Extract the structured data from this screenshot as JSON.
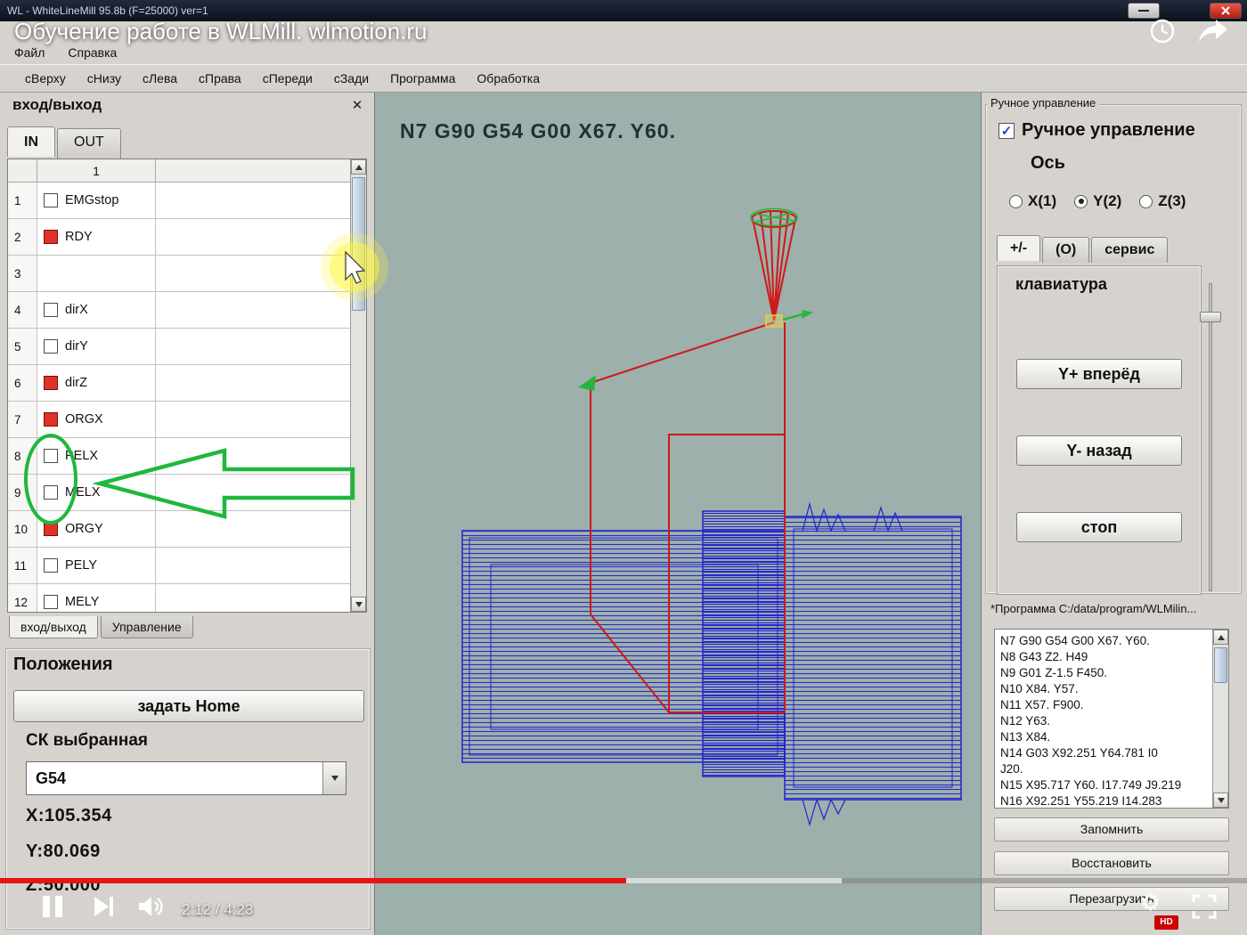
{
  "titlebar": {
    "title": "WL - WhiteLineMill 95.8b (F=25000) ver=1"
  },
  "video": {
    "title": "Обучение работе в WLMill. wlmotion.ru",
    "current_time": "2:12 / 4:23",
    "hd_badge": "HD",
    "progress_pct": 50.2,
    "buffer_pct": 67.5
  },
  "icons": {
    "close_panel": "✕",
    "check": "✓",
    "settings": "⚙"
  },
  "menubar": [
    "Файл",
    "Справка"
  ],
  "toolbar": [
    "сВерху",
    "сНизу",
    "сЛева",
    "сПрава",
    "сПереди",
    "сЗади",
    "Программа",
    "Обработка"
  ],
  "io_panel": {
    "title": "вход/выход",
    "tabs": [
      "IN",
      "OUT"
    ],
    "active_tab": "IN",
    "column_header": "1",
    "rows": [
      {
        "num": "1",
        "label": "EMGstop",
        "state": "off"
      },
      {
        "num": "2",
        "label": "RDY",
        "state": "on"
      },
      {
        "num": "3",
        "label": "",
        "state": "none"
      },
      {
        "num": "4",
        "label": "dirX",
        "state": "off"
      },
      {
        "num": "5",
        "label": "dirY",
        "state": "off"
      },
      {
        "num": "6",
        "label": "dirZ",
        "state": "on"
      },
      {
        "num": "7",
        "label": "ORGX",
        "state": "on"
      },
      {
        "num": "8",
        "label": "PELX",
        "state": "off"
      },
      {
        "num": "9",
        "label": "MELX",
        "state": "off"
      },
      {
        "num": "10",
        "label": "ORGY",
        "state": "on"
      },
      {
        "num": "11",
        "label": "PELY",
        "state": "off"
      },
      {
        "num": "12",
        "label": "MELY",
        "state": "off"
      }
    ],
    "bottom_tabs": [
      "вход/выход",
      "Управление"
    ]
  },
  "positions": {
    "title": "Положения",
    "set_home_button": "задать Home",
    "cs_label": "СК выбранная",
    "cs_selected": "G54",
    "x_value": "X:105.354",
    "y_value": "Y:80.069",
    "z_value": "Z:50.000"
  },
  "viewport": {
    "gcode_overlay": "N7 G90 G54 G00 X67. Y60."
  },
  "manual_panel": {
    "group_title": "Ручное управление",
    "enable_label": "Ручное управление",
    "axis_label": "Ось",
    "axis_options": [
      "X(1)",
      "Y(2)",
      "Z(3)"
    ],
    "axis_selected": "Y(2)",
    "tabs": [
      "+/-",
      "(О)",
      "сервис"
    ],
    "active_tab": "+/-",
    "keyboard_label": "клавиатура",
    "jog_forward_button": "Y+ вперёд",
    "jog_back_button": "Y- назад",
    "stop_button": "стоп"
  },
  "program_panel": {
    "group_title": "*Программа C:/data/program/WLMilin...",
    "gcode_lines": [
      "N7 G90 G54 G00 X67. Y60.",
      "N8 G43 Z2. H49",
      "N9 G01 Z-1.5 F450.",
      "N10 X84. Y57.",
      "N11 X57. F900.",
      "N12 Y63.",
      "N13 X84.",
      "N14 G03 X92.251 Y64.781 I0",
      "J20.",
      "N15 X95.717 Y60. I17.749 J9.219",
      "N16 X92.251 Y55.219 I14.283"
    ],
    "buttons": [
      "Запомнить",
      "Восстановить",
      "Перезагрузить"
    ]
  }
}
